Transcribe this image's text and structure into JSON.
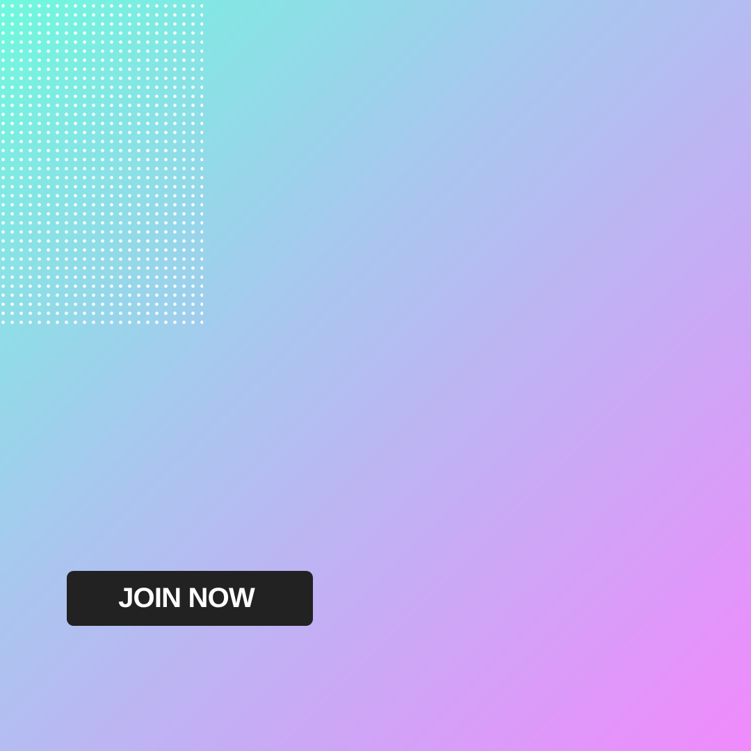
{
  "cta": {
    "label": "JOIN NOW"
  },
  "colors": {
    "gradient_start": "#6ef9dd",
    "gradient_middle": "#a6c9ee",
    "gradient_lavender": "#c7abf5",
    "gradient_end": "#f08afc",
    "button": "#222222",
    "button_text": "#ffffff",
    "dot_pattern": "#ffffff"
  }
}
